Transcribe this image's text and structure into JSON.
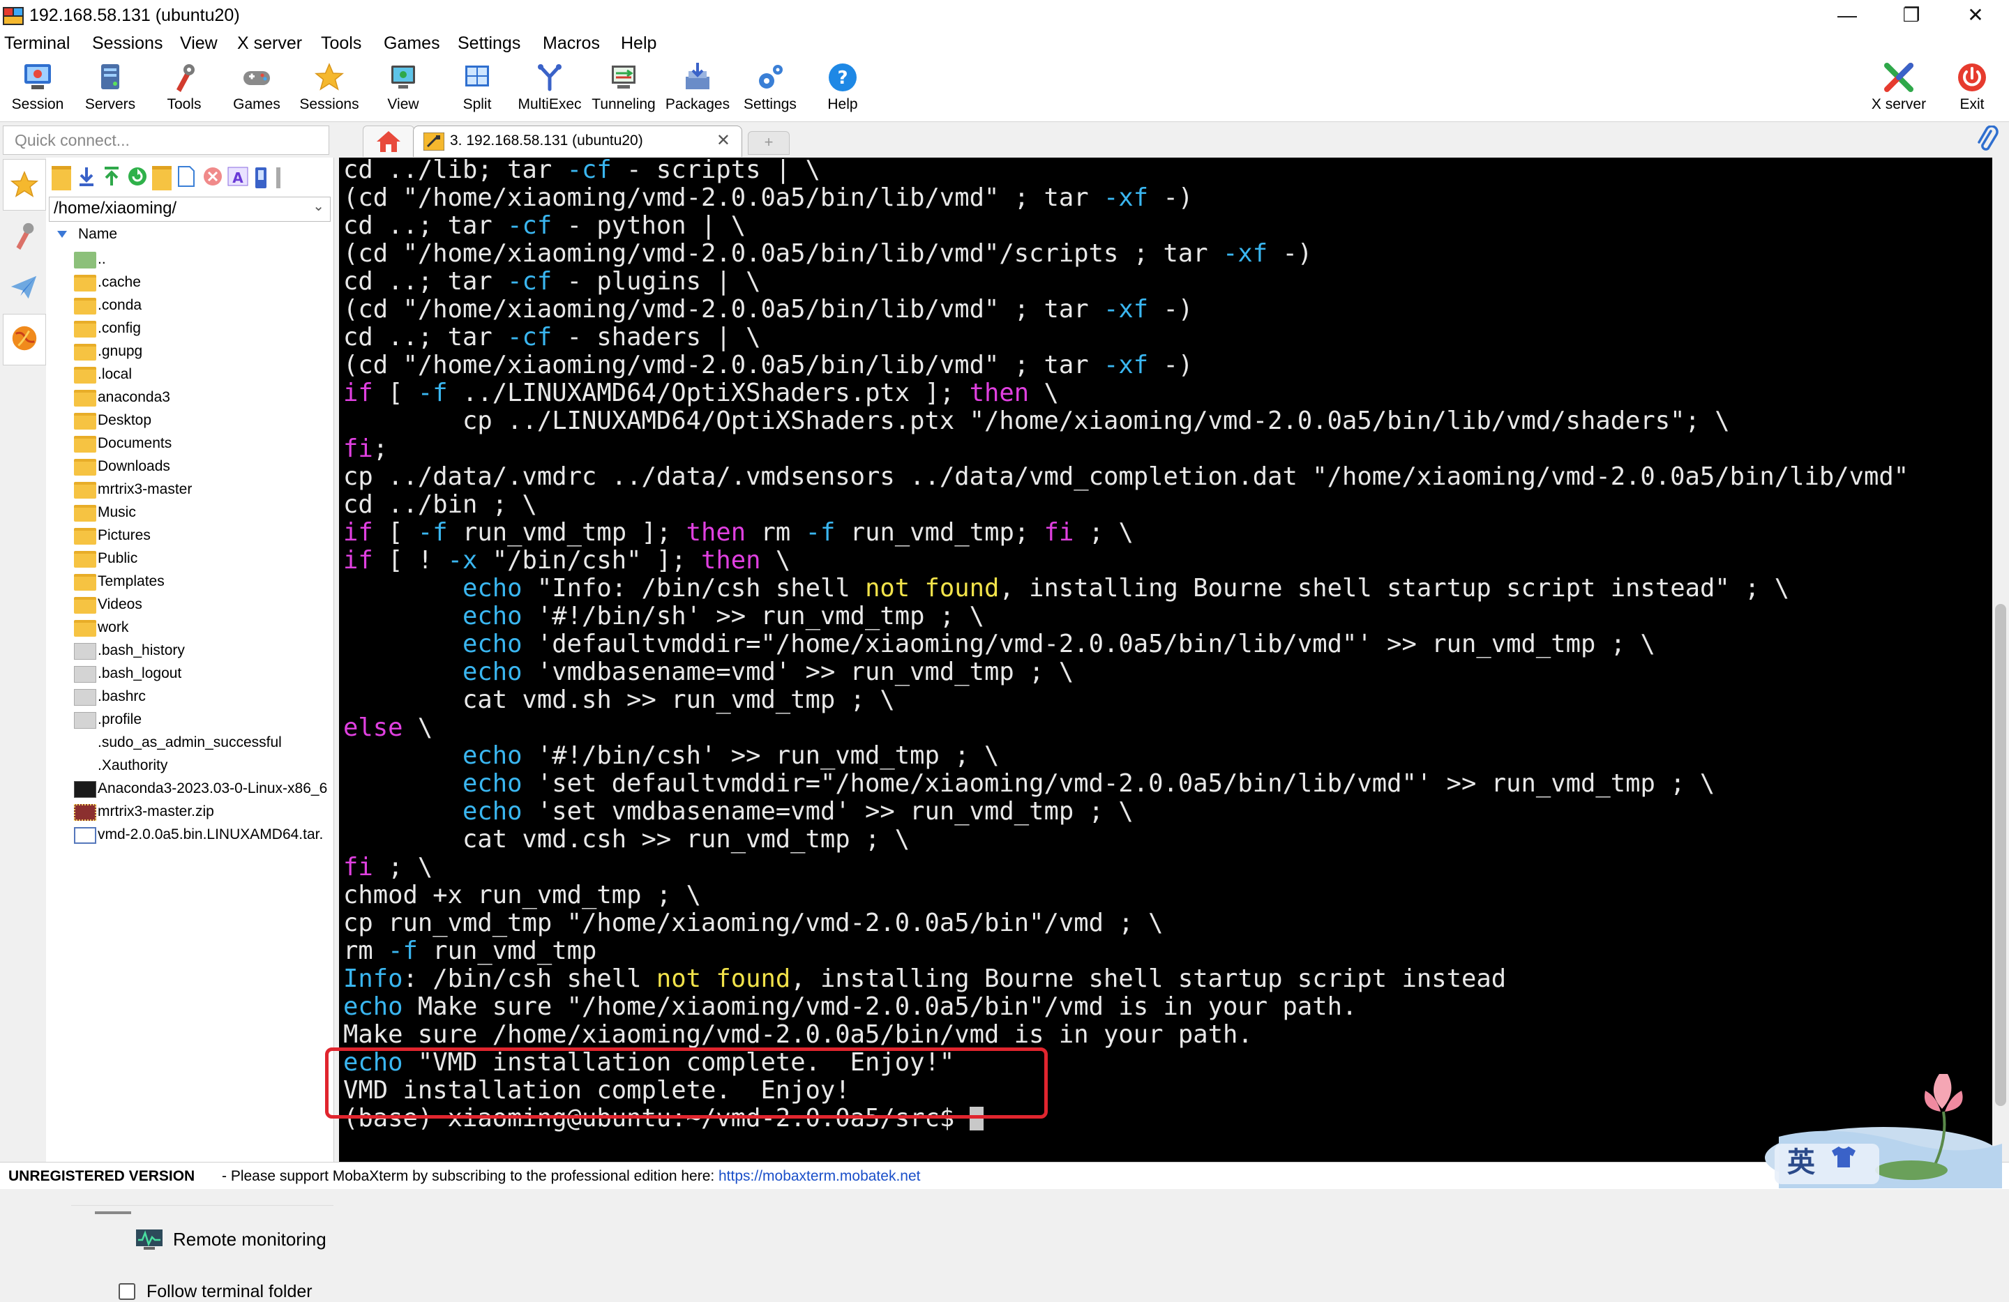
{
  "window": {
    "title": "192.168.58.131 (ubuntu20)",
    "minimize": "—",
    "maximize": "❐",
    "close": "✕"
  },
  "menu": [
    "Terminal",
    "Sessions",
    "View",
    "X server",
    "Tools",
    "Games",
    "Settings",
    "Macros",
    "Help"
  ],
  "toolbar": {
    "items": [
      "Session",
      "Servers",
      "Tools",
      "Games",
      "Sessions",
      "View",
      "Split",
      "MultiExec",
      "Tunneling",
      "Packages",
      "Settings",
      "Help"
    ],
    "xserver": "X server",
    "exit": "Exit"
  },
  "quick_connect": {
    "placeholder": "Quick connect..."
  },
  "tabs": {
    "session_tab": "3. 192.168.58.131 (ubuntu20)",
    "close": "✕",
    "new_tab": "+"
  },
  "sftp": {
    "path": "/home/xiaoming/",
    "column": "Name",
    "files": [
      {
        "name": "..",
        "kind": "up"
      },
      {
        "name": ".cache",
        "kind": "folder"
      },
      {
        "name": ".conda",
        "kind": "folder"
      },
      {
        "name": ".config",
        "kind": "folder"
      },
      {
        "name": ".gnupg",
        "kind": "folder"
      },
      {
        "name": ".local",
        "kind": "folder"
      },
      {
        "name": "anaconda3",
        "kind": "folder"
      },
      {
        "name": "Desktop",
        "kind": "folder"
      },
      {
        "name": "Documents",
        "kind": "folder"
      },
      {
        "name": "Downloads",
        "kind": "folder"
      },
      {
        "name": "mrtrix3-master",
        "kind": "folder"
      },
      {
        "name": "Music",
        "kind": "folder"
      },
      {
        "name": "Pictures",
        "kind": "folder"
      },
      {
        "name": "Public",
        "kind": "folder"
      },
      {
        "name": "Templates",
        "kind": "folder"
      },
      {
        "name": "Videos",
        "kind": "folder"
      },
      {
        "name": "work",
        "kind": "folder"
      },
      {
        "name": ".bash_history",
        "kind": "file"
      },
      {
        "name": ".bash_logout",
        "kind": "file"
      },
      {
        "name": ".bashrc",
        "kind": "file"
      },
      {
        "name": ".profile",
        "kind": "file"
      },
      {
        "name": ".sudo_as_admin_successful",
        "kind": "blank"
      },
      {
        "name": ".Xauthority",
        "kind": "blank"
      },
      {
        "name": "Anaconda3-2023.03-0-Linux-x86_6",
        "kind": "app"
      },
      {
        "name": "mrtrix3-master.zip",
        "kind": "zip"
      },
      {
        "name": "vmd-2.0.0a5.bin.LINUXAMD64.tar.",
        "kind": "tar"
      }
    ],
    "remote_monitoring": "Remote monitoring",
    "follow_folder": "Follow terminal folder"
  },
  "terminal": {
    "lines": [
      [
        {
          "t": "cd ../lib; tar "
        },
        {
          "t": "-cf",
          "c": "b"
        },
        {
          "t": " - scripts | \\"
        }
      ],
      [
        {
          "t": "(cd \"/home/xiaoming/vmd-2.0.0a5/bin/lib/vmd\" ; tar "
        },
        {
          "t": "-xf",
          "c": "b"
        },
        {
          "t": " -)"
        }
      ],
      [
        {
          "t": "cd ..; tar "
        },
        {
          "t": "-cf",
          "c": "b"
        },
        {
          "t": " - python | \\"
        }
      ],
      [
        {
          "t": "(cd \"/home/xiaoming/vmd-2.0.0a5/bin/lib/vmd\"/scripts ; tar "
        },
        {
          "t": "-xf",
          "c": "b"
        },
        {
          "t": " -)"
        }
      ],
      [
        {
          "t": "cd ..; tar "
        },
        {
          "t": "-cf",
          "c": "b"
        },
        {
          "t": " - plugins | \\"
        }
      ],
      [
        {
          "t": "(cd \"/home/xiaoming/vmd-2.0.0a5/bin/lib/vmd\" ; tar "
        },
        {
          "t": "-xf",
          "c": "b"
        },
        {
          "t": " -)"
        }
      ],
      [
        {
          "t": "cd ..; tar "
        },
        {
          "t": "-cf",
          "c": "b"
        },
        {
          "t": " - shaders | \\"
        }
      ],
      [
        {
          "t": "(cd \"/home/xiaoming/vmd-2.0.0a5/bin/lib/vmd\" ; tar "
        },
        {
          "t": "-xf",
          "c": "b"
        },
        {
          "t": " -)"
        }
      ],
      [
        {
          "t": "if",
          "c": "k"
        },
        {
          "t": " [ "
        },
        {
          "t": "-f",
          "c": "b"
        },
        {
          "t": " ../LINUXAMD64/OptiXShaders.ptx ]; "
        },
        {
          "t": "then",
          "c": "k"
        },
        {
          "t": " \\"
        }
      ],
      [
        {
          "t": "        cp ../LINUXAMD64/OptiXShaders.ptx \"/home/xiaoming/vmd-2.0.0a5/bin/lib/vmd/shaders\"; \\"
        }
      ],
      [
        {
          "t": "fi",
          "c": "k"
        },
        {
          "t": ";"
        }
      ],
      [
        {
          "t": "cp ../data/.vmdrc ../data/.vmdsensors ../data/vmd_completion.dat \"/home/xiaoming/vmd-2.0.0a5/bin/lib/vmd\""
        }
      ],
      [
        {
          "t": "cd ../bin ; \\"
        }
      ],
      [
        {
          "t": "if",
          "c": "k"
        },
        {
          "t": " [ "
        },
        {
          "t": "-f",
          "c": "b"
        },
        {
          "t": " run_vmd_tmp ]; "
        },
        {
          "t": "then",
          "c": "k"
        },
        {
          "t": " rm "
        },
        {
          "t": "-f",
          "c": "b"
        },
        {
          "t": " run_vmd_tmp; "
        },
        {
          "t": "fi",
          "c": "k"
        },
        {
          "t": " ; \\"
        }
      ],
      [
        {
          "t": "if",
          "c": "k"
        },
        {
          "t": " [ ! "
        },
        {
          "t": "-x",
          "c": "b"
        },
        {
          "t": " \"/bin/csh\" ]; "
        },
        {
          "t": "then",
          "c": "k"
        },
        {
          "t": " \\"
        }
      ],
      [
        {
          "t": "        "
        },
        {
          "t": "echo",
          "c": "b"
        },
        {
          "t": " \"Info: /bin/csh shell "
        },
        {
          "t": "not found",
          "c": "y"
        },
        {
          "t": ", installing Bourne shell startup script instead\" ; \\"
        }
      ],
      [
        {
          "t": "        "
        },
        {
          "t": "echo",
          "c": "b"
        },
        {
          "t": " '#!/bin/sh' >> run_vmd_tmp ; \\"
        }
      ],
      [
        {
          "t": "        "
        },
        {
          "t": "echo",
          "c": "b"
        },
        {
          "t": " 'defaultvmddir=\"/home/xiaoming/vmd-2.0.0a5/bin/lib/vmd\"' >> run_vmd_tmp ; \\"
        }
      ],
      [
        {
          "t": "        "
        },
        {
          "t": "echo",
          "c": "b"
        },
        {
          "t": " 'vmdbasename=vmd' >> run_vmd_tmp ; \\"
        }
      ],
      [
        {
          "t": "        cat vmd.sh >> run_vmd_tmp ; \\"
        }
      ],
      [
        {
          "t": "else",
          "c": "k"
        },
        {
          "t": " \\"
        }
      ],
      [
        {
          "t": "        "
        },
        {
          "t": "echo",
          "c": "b"
        },
        {
          "t": " '#!/bin/csh' >> run_vmd_tmp ; \\"
        }
      ],
      [
        {
          "t": "        "
        },
        {
          "t": "echo",
          "c": "b"
        },
        {
          "t": " 'set defaultvmddir=\"/home/xiaoming/vmd-2.0.0a5/bin/lib/vmd\"' >> run_vmd_tmp ; \\"
        }
      ],
      [
        {
          "t": "        "
        },
        {
          "t": "echo",
          "c": "b"
        },
        {
          "t": " 'set vmdbasename=vmd' >> run_vmd_tmp ; \\"
        }
      ],
      [
        {
          "t": "        cat vmd.csh >> run_vmd_tmp ; \\"
        }
      ],
      [
        {
          "t": "fi",
          "c": "k"
        },
        {
          "t": " ; \\"
        }
      ],
      [
        {
          "t": "chmod +x run_vmd_tmp ; \\"
        }
      ],
      [
        {
          "t": "cp run_vmd_tmp \"/home/xiaoming/vmd-2.0.0a5/bin\"/vmd ; \\"
        }
      ],
      [
        {
          "t": "rm "
        },
        {
          "t": "-f",
          "c": "b"
        },
        {
          "t": " run_vmd_tmp"
        }
      ],
      [
        {
          "t": "Info",
          "c": "b"
        },
        {
          "t": ": /bin/csh shell "
        },
        {
          "t": "not found",
          "c": "y"
        },
        {
          "t": ", installing Bourne shell startup script instead"
        }
      ],
      [
        {
          "t": "echo",
          "c": "b"
        },
        {
          "t": " Make sure \"/home/xiaoming/vmd-2.0.0a5/bin\"/vmd is in your path."
        }
      ],
      [
        {
          "t": "Make sure /home/xiaoming/vmd-2.0.0a5/bin/vmd is in your path."
        }
      ],
      [
        {
          "t": "echo",
          "c": "b"
        },
        {
          "t": " \"VMD installation complete.  Enjoy!\""
        }
      ],
      [
        {
          "t": "VMD installation complete.  Enjoy!"
        }
      ],
      [
        {
          "t": "(base) xiaoming@ubuntu:~/vmd-2.0.0a5/src$ "
        }
      ]
    ]
  },
  "status": {
    "unregistered": "UNREGISTERED VERSION",
    "message": "-   Please support MobaXterm by subscribing to the professional edition here:",
    "link": "https://mobaxterm.mobatek.net"
  },
  "ime": {
    "label": "英"
  },
  "colors": {
    "keyword": "#e040e0",
    "option": "#3ab6f0",
    "warning": "#f2e34a",
    "highlight": "#e0252e"
  }
}
